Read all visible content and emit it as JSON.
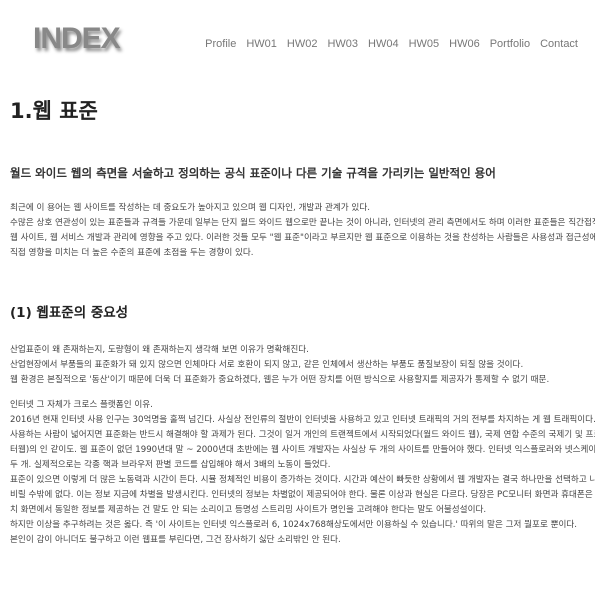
{
  "header": {
    "logo": "INDEX",
    "nav": [
      "Profile",
      "HW01",
      "HW02",
      "HW03",
      "HW04",
      "HW05",
      "HW06",
      "Portfolio",
      "Contact"
    ]
  },
  "main": {
    "title": "1.웹 표준",
    "lead": "월드 와이드 웹의 측면을 서술하고 정의하는 공식 표준이나 다른 기술 규격을 가리키는 일반적인 용어",
    "intro_lines": [
      "최근에 이 용어는 웹 사이트를 작성하는 데 중요도가 높아지고 있으며 웹 디자인, 개발과 관계가 있다.",
      "수많은 상호 연관성이 있는 표준들과 규격들 가운데 일부는 단지 월드 와이드 웹으로만 끝나는 것이 아니라, 인터넷의 관리 측면에서도 하며 이러한 표준들은 직간접적으로",
      "웹 사이트, 웹 서비스 개발과 관리에 영향을 주고 있다. 이러한 것들 모두 \"웹 표준\"이라고 부르지만 웹 표준으로 이용하는 것을 찬성하는 사람들은 사용성과 접근성에",
      "직접 영향을 미치는 더 높은 수준의 표준에 초점을 두는 경향이 있다."
    ],
    "section1": {
      "title": "(1) 웹표준의 중요성",
      "para_a": [
        "산업표준이 왜 존재하는지, 도량형이 왜 존재하는지 생각해 보면 이유가 명확해진다.",
        "산업현장에서 부품들의 표준화가 돼 있지 않으면 인체마다 서로 호환이 되지 않고, 같은 인체에서 생산하는 부품도 품질보장이 되질 않을 것이다.",
        "웹 환경은 본질적으로 '동산'이기 때문에 더욱 더 표준화가 중요하겠다, 웹은 누가 어떤 장치를 어떤 방식으로 사용할지를 제공자가 통제할 수 없기 때문."
      ],
      "para_b": [
        "인터넷 그 자체가 크로스 플랫폼인 이유.",
        "2016년 현재 인터넷 사용 인구는 30억명을 훌쩍 넘긴다. 사실상 전인류의 절반이 인터넷을 사용하고 있고 인터넷 트래픽의 거의 전부를 차지하는 게 웹 트래픽이다.",
        "사용하는 사람이 넓어지면 표준화는 반드시 해결해야 할 과제가 된다. 그것이 일거 개인의 트랜젝트에서 시작되었다(월드 와이드 웹), 국제 연합 수준의 국제기 및 프로젝트(미",
        "터웹)의 인 같이도. 웹 표준이 없던 1990년대 말 ~ 2000년대 초반에는 웹 사이트 개발자는 사실상 두 개의 사이트를 만들어야 했다. 인터넷 익스플로러와 넷스케이프용의",
        "두 개. 실제적으로는 각종 핵과 브라우저 판별 코드를 삽입해야 해서 3배의 노동이 들었다.",
        "표준이 있으면 이렇게 더 많은 노동력과 시간이 든다. 시뮬 정체적인 비용이 증가하는 것이다. 시간과 예산이 빠듯한 상황에서 웹 개발자는 결국 하나만을 선택하고 나머지를",
        "비릴 수밖에 없다. 이는 정보 지금에 차별을 발생시킨다. 인터넷의 정보는 차별없이 제공되어야 한다. 물론 이상과 현실은 다르다. 당장은 PC모니터 화면과 휴대폰은 스마트워",
        "치 화면에서 동일한 정보를 제공하는 건 말도 안 되는 소리이고 등명성 스트리밍 사이트가 명인을 고려해야 한다는 말도 어불성설이다.",
        "하지만 이상을 추구하려는 것은 옳다. 즉 '이 사이트는 인터넷 익스플로러 6, 1024x768해상도에서만 이용하실 수 있습니다.' 따위의 말은 그저 뭘포로 뿐이다.",
        "본인이 감이 아니더도 불구하고 이런 웹표를 부린다면, 그건 장사하기 싫단 소리밖인 안 된다."
      ]
    }
  }
}
